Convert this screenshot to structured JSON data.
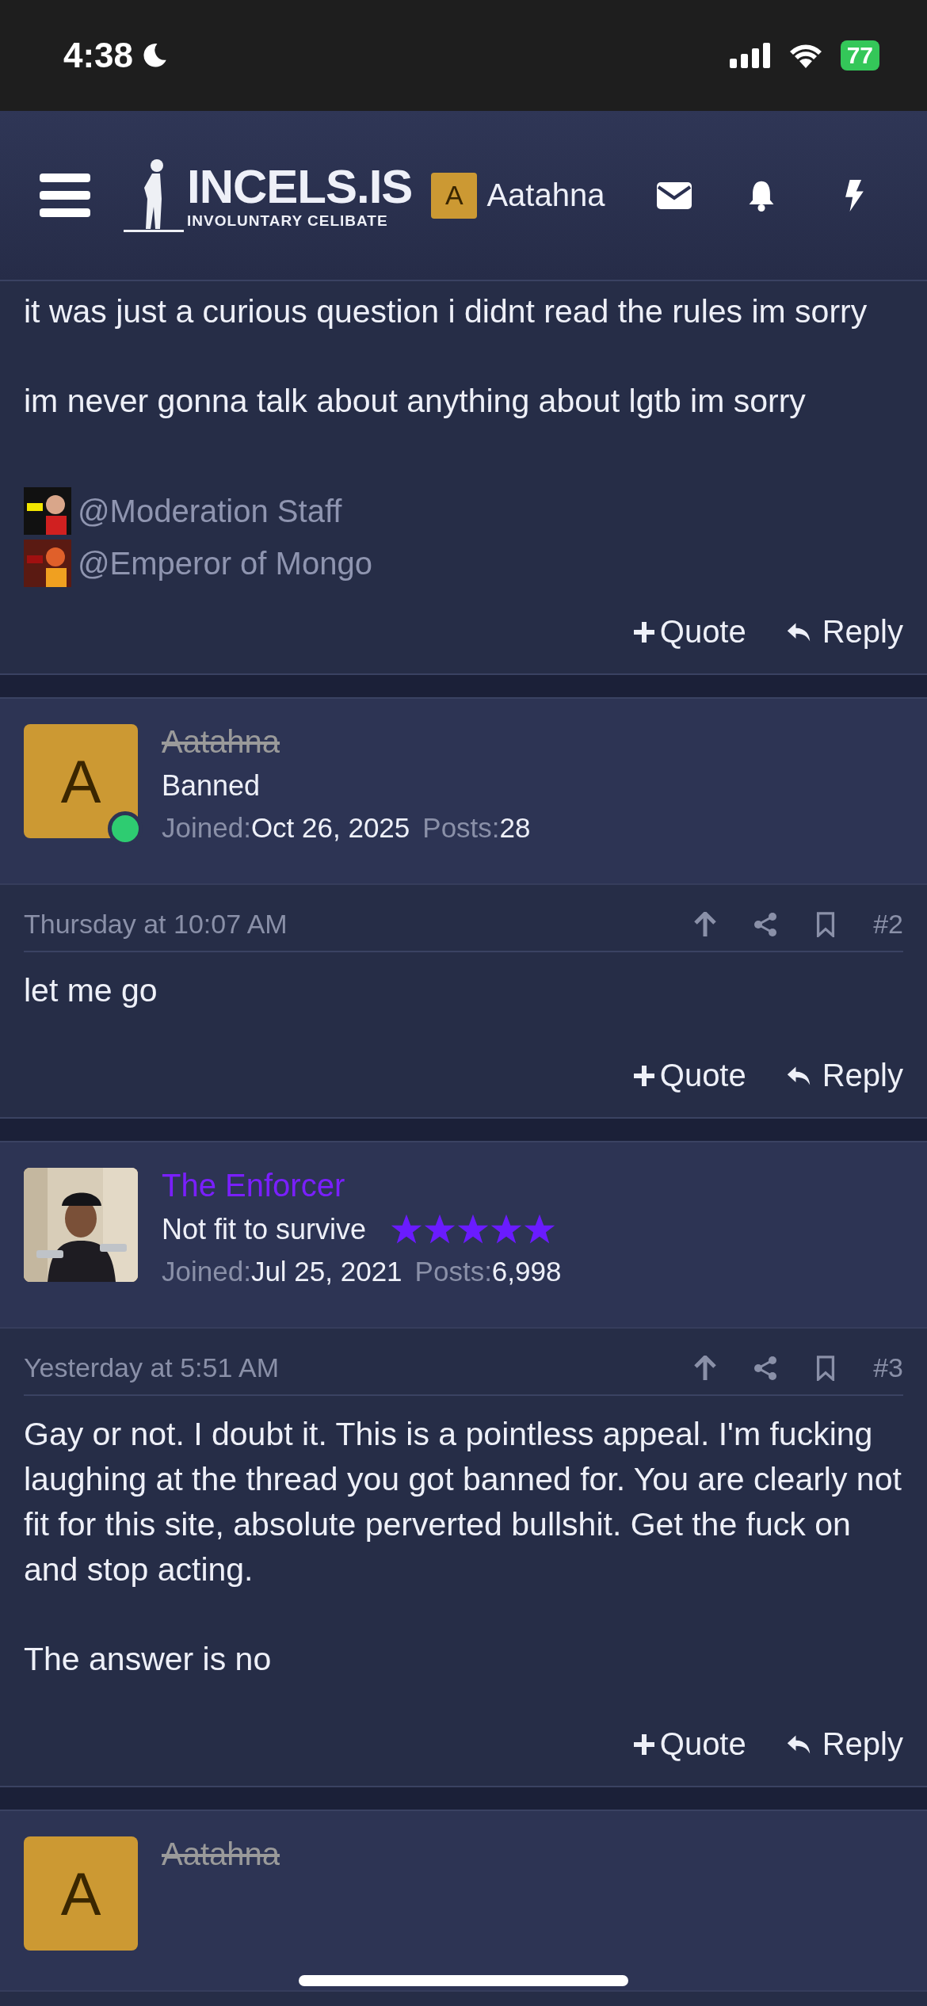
{
  "status_bar": {
    "time": "4:38",
    "battery": "77"
  },
  "header": {
    "logo_title": "INCELS.IS",
    "logo_subtitle": "INVOLUNTARY CELIBATE",
    "user": {
      "initial": "A",
      "name": "Aatahna"
    }
  },
  "posts": [
    {
      "kind": "tail",
      "body": [
        "it was just a curious question i didnt read the rules im sorry",
        "im never gonna talk about anything about lgtb im sorry"
      ],
      "mentions": [
        "@Moderation Staff",
        "@Emperor of Mongo"
      ],
      "actions": [
        "Quote",
        "Reply"
      ]
    },
    {
      "kind": "full",
      "author": {
        "kind": "letter",
        "initial": "A",
        "name": "Aatahna",
        "banned": true,
        "online": true,
        "title": "Banned",
        "joined_label": "Joined:",
        "joined": "Oct 26, 2025",
        "posts_label": "Posts:",
        "posts": "28"
      },
      "time": "Thursday at 10:07 AM",
      "number": "#2",
      "body": [
        "let me go"
      ],
      "actions": [
        "Quote",
        "Reply"
      ]
    },
    {
      "kind": "full",
      "author": {
        "kind": "picture",
        "name": "The Enforcer",
        "banned": false,
        "color": "#7a1fff",
        "title": "Not fit to survive",
        "stars": 5,
        "joined_label": "Joined:",
        "joined": "Jul 25, 2021",
        "posts_label": "Posts:",
        "posts": "6,998"
      },
      "time": "Yesterday at 5:51 AM",
      "number": "#3",
      "body": [
        "Gay or not. I doubt it. This is a pointless appeal. I'm fucking laughing at the thread you got banned for. You are clearly not fit for this site, absolute perverted bullshit. Get the fuck on and stop acting.",
        "The answer is no"
      ],
      "actions": [
        "Quote",
        "Reply"
      ]
    },
    {
      "kind": "head",
      "author": {
        "kind": "letter",
        "initial": "A",
        "name": "Aatahna",
        "banned": true
      }
    }
  ]
}
